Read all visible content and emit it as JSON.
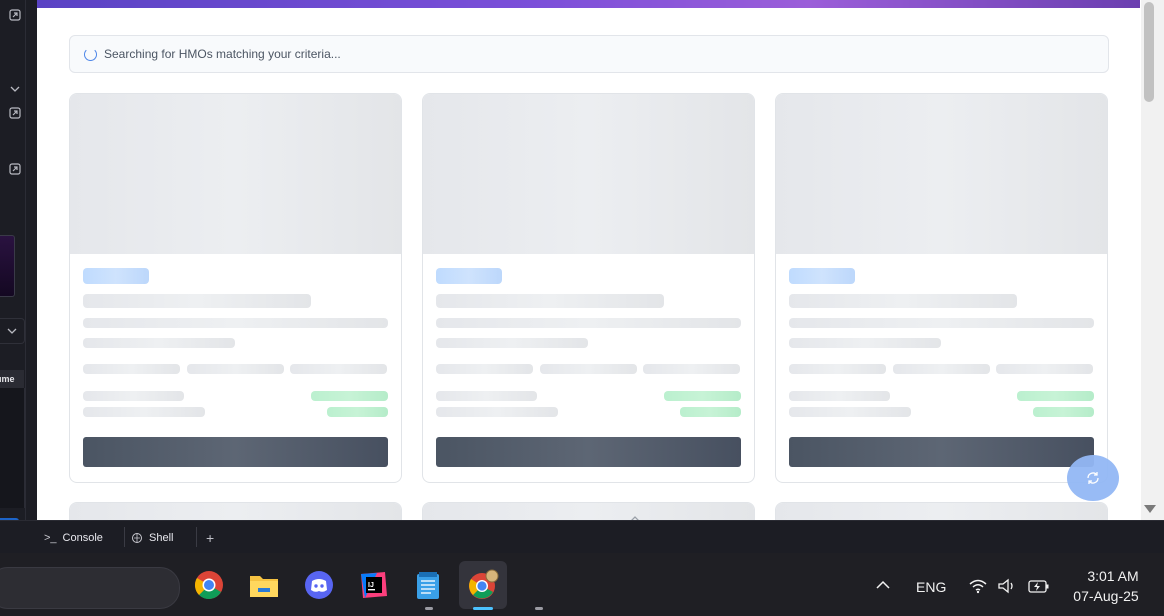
{
  "browser": {
    "status_text": "Searching for HMOs matching your criteria...",
    "scroll_position_fraction": 0.0,
    "loading": true
  },
  "left_panel": {
    "tab_label": "ume"
  },
  "ide_tabs": [
    {
      "label": "Console",
      "icon": "terminal-icon"
    },
    {
      "label": "Shell",
      "icon": "shell-icon"
    },
    {
      "label": "+",
      "icon": "add-tab-icon"
    }
  ],
  "taskbar": {
    "apps": [
      "chrome-icon",
      "file-explorer-icon",
      "discord-icon",
      "intellij-icon",
      "notepad-icon",
      "chrome-profile-icon"
    ],
    "language": "ENG",
    "time": "3:01 AM",
    "date": "07-Aug-25"
  },
  "colors": {
    "accent_gradient_start": "#5a43c4",
    "accent_gradient_end": "#9b5ed9",
    "skeleton": "#e5e7eb",
    "skeleton_blue": "#bfdbfe",
    "skeleton_green": "#bbf0cf",
    "skeleton_button": "#4b5563",
    "fab": "#93b8f5"
  }
}
